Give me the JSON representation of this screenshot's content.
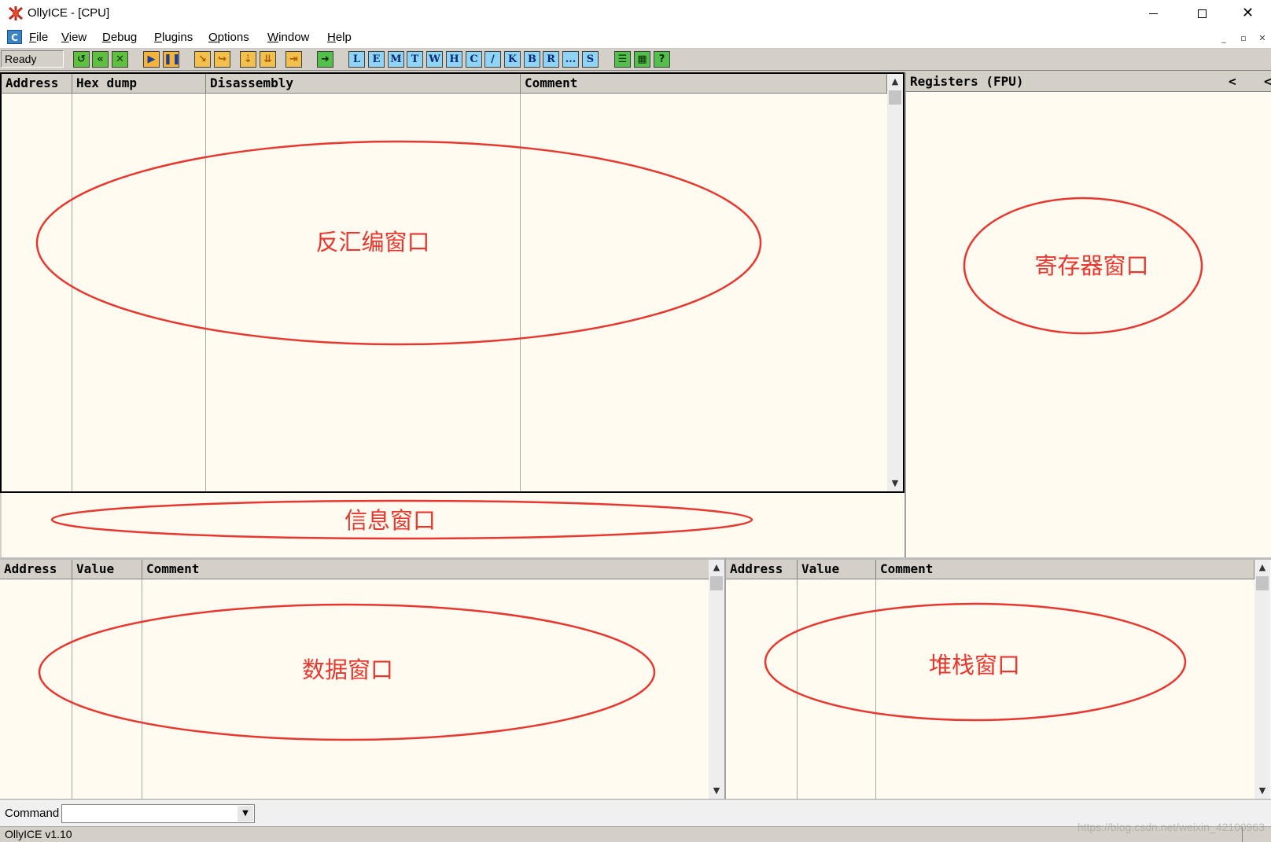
{
  "window": {
    "title": "OllyICE - [CPU]",
    "controls": {
      "minimize": "minimize-icon",
      "maximize": "maximize-icon",
      "close": "close-icon"
    }
  },
  "menu": {
    "items": [
      "File",
      "View",
      "Debug",
      "Plugins",
      "Options",
      "Window",
      "Help"
    ],
    "mdi_controls": [
      "_",
      "▫",
      "✕"
    ]
  },
  "toolbar": {
    "status": "Ready",
    "icon_buttons": [
      "open-icon",
      "restart-icon",
      "close-program-icon",
      "run-icon",
      "pause-icon",
      "step-into-icon",
      "step-over-icon",
      "trace-into-icon",
      "trace-over-icon",
      "execute-till-return-icon",
      "go-to-user-code-icon"
    ],
    "letters": [
      "L",
      "E",
      "M",
      "T",
      "W",
      "H",
      "C",
      "/",
      "K",
      "B",
      "R",
      "...",
      "S"
    ],
    "extra_buttons": [
      "options-icon",
      "appearance-icon",
      "help-icon"
    ],
    "help_glyph": "?"
  },
  "disassembly": {
    "columns": [
      "Address",
      "Hex dump",
      "Disassembly",
      "Comment"
    ]
  },
  "registers": {
    "title": "Registers (FPU)",
    "arrow": "<"
  },
  "dump": {
    "columns": [
      "Address",
      "Value",
      "Comment"
    ]
  },
  "stack": {
    "columns": [
      "Address",
      "Value",
      "Comment"
    ]
  },
  "annotations": {
    "disassembly": "反汇编窗口",
    "registers": "寄存器窗口",
    "info": "信息窗口",
    "dump": "数据窗口",
    "stack": "堆栈窗口"
  },
  "command": {
    "label": "Command",
    "value": ""
  },
  "status_bar": {
    "text": "OllyICE v1.10"
  },
  "watermark": "https://blog.csdn.net/weixin_42100963",
  "colors": {
    "pane_bg": "#fffbf0",
    "header_bg": "#d4d0c8",
    "annotation": "#e8372e",
    "letter_button": "#8fd3f5"
  }
}
